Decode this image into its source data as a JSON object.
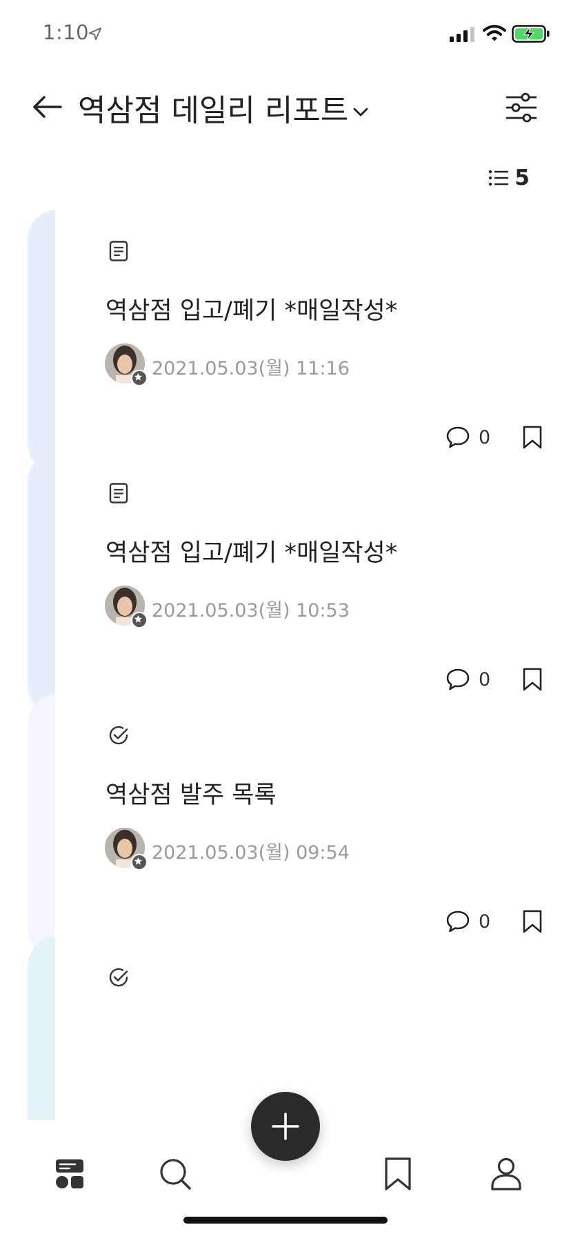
{
  "status_bar": {
    "time": "1:10"
  },
  "header": {
    "title": "역삼점 데일리 리포트"
  },
  "post_count": "5",
  "posts": [
    {
      "title": "역삼점 입고/폐기 *매일작성*",
      "date": "2021.05.03(월) 11:16",
      "comments": "0",
      "type_icon": "document-icon",
      "accent": "#e6eefb"
    },
    {
      "title": "역삼점 입고/폐기 *매일작성*",
      "date": "2021.05.03(월) 10:53",
      "comments": "0",
      "type_icon": "document-icon",
      "accent": "#e6eefb"
    },
    {
      "title": "역삼점 발주 목록",
      "date": "2021.05.03(월) 09:54",
      "comments": "0",
      "type_icon": "check-circle-icon",
      "accent": "#f4f5fd"
    },
    {
      "type_icon": "check-circle-icon",
      "accent": "#e4f3f6"
    }
  ],
  "nav": [
    "feed-icon",
    "search-icon",
    "bookmark-icon",
    "profile-icon"
  ]
}
